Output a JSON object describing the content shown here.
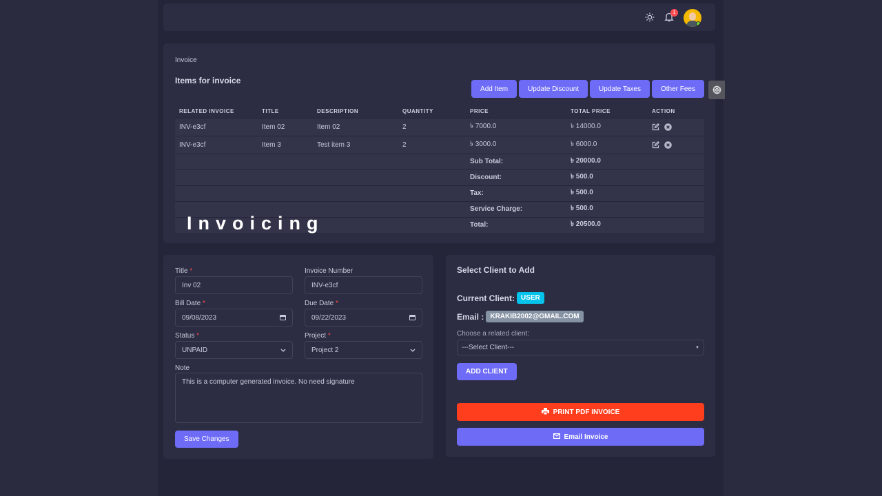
{
  "header": {
    "notification_count": "1"
  },
  "items_card": {
    "breadcrumb": "Invoice",
    "title": "Items for invoice",
    "buttons": {
      "add_item": "Add Item",
      "update_discount": "Update Discount",
      "update_taxes": "Update Taxes",
      "other_fees": "Other Fees"
    },
    "columns": [
      "RELATED INVOICE",
      "TITLE",
      "DESCRIPTION",
      "QUANTITY",
      "PRICE",
      "TOTAL PRICE",
      "ACTION"
    ],
    "rows": [
      {
        "invoice": "INV-e3cf",
        "title": "Item 02",
        "description": "Item 02",
        "quantity": "2",
        "price": "৳ 7000.0",
        "total": "৳ 14000.0"
      },
      {
        "invoice": "INV-e3cf",
        "title": "Item 3",
        "description": "Test item 3",
        "quantity": "2",
        "price": "৳ 3000.0",
        "total": "৳ 6000.0"
      }
    ],
    "summary": [
      {
        "label": "Sub Total:",
        "value": "৳ 20000.0"
      },
      {
        "label": "Discount:",
        "value": "৳ 500.0"
      },
      {
        "label": "Tax:",
        "value": "৳ 500.0"
      },
      {
        "label": "Service Charge:",
        "value": "৳ 500.0"
      },
      {
        "label": "Total:",
        "value": "৳ 20500.0"
      }
    ]
  },
  "overlay_title": "Invoicing",
  "form": {
    "title_label": "Title",
    "title_value": "Inv 02",
    "invoice_number_label": "Invoice Number",
    "invoice_number_value": "INV-e3cf",
    "bill_date_label": "Bill Date",
    "bill_date_value": "09/08/2023",
    "due_date_label": "Due Date",
    "due_date_value": "09/22/2023",
    "status_label": "Status",
    "status_value": "UNPAID",
    "project_label": "Project",
    "project_value": "Project 2",
    "note_label": "Note",
    "note_value": "This is a computer generated invoice. No need signature",
    "save_label": "Save Changes",
    "required_mark": "*"
  },
  "client": {
    "title": "Select Client to Add",
    "current_label": "Current Client:",
    "current_value": "USER",
    "email_label": "Email :",
    "email_value": "KRAKIB2002@GMAIL.COM",
    "choose_label": "Choose a related client:",
    "select_value": "---Select Client---",
    "add_label": "ADD CLIENT",
    "print_label": "PRINT PDF INVOICE",
    "email_invoice_label": "Email Invoice"
  },
  "colors": {
    "primary": "#6e6cf7",
    "danger": "#ff3e1d",
    "info": "#03c3ec",
    "secondary": "#8592a3"
  }
}
